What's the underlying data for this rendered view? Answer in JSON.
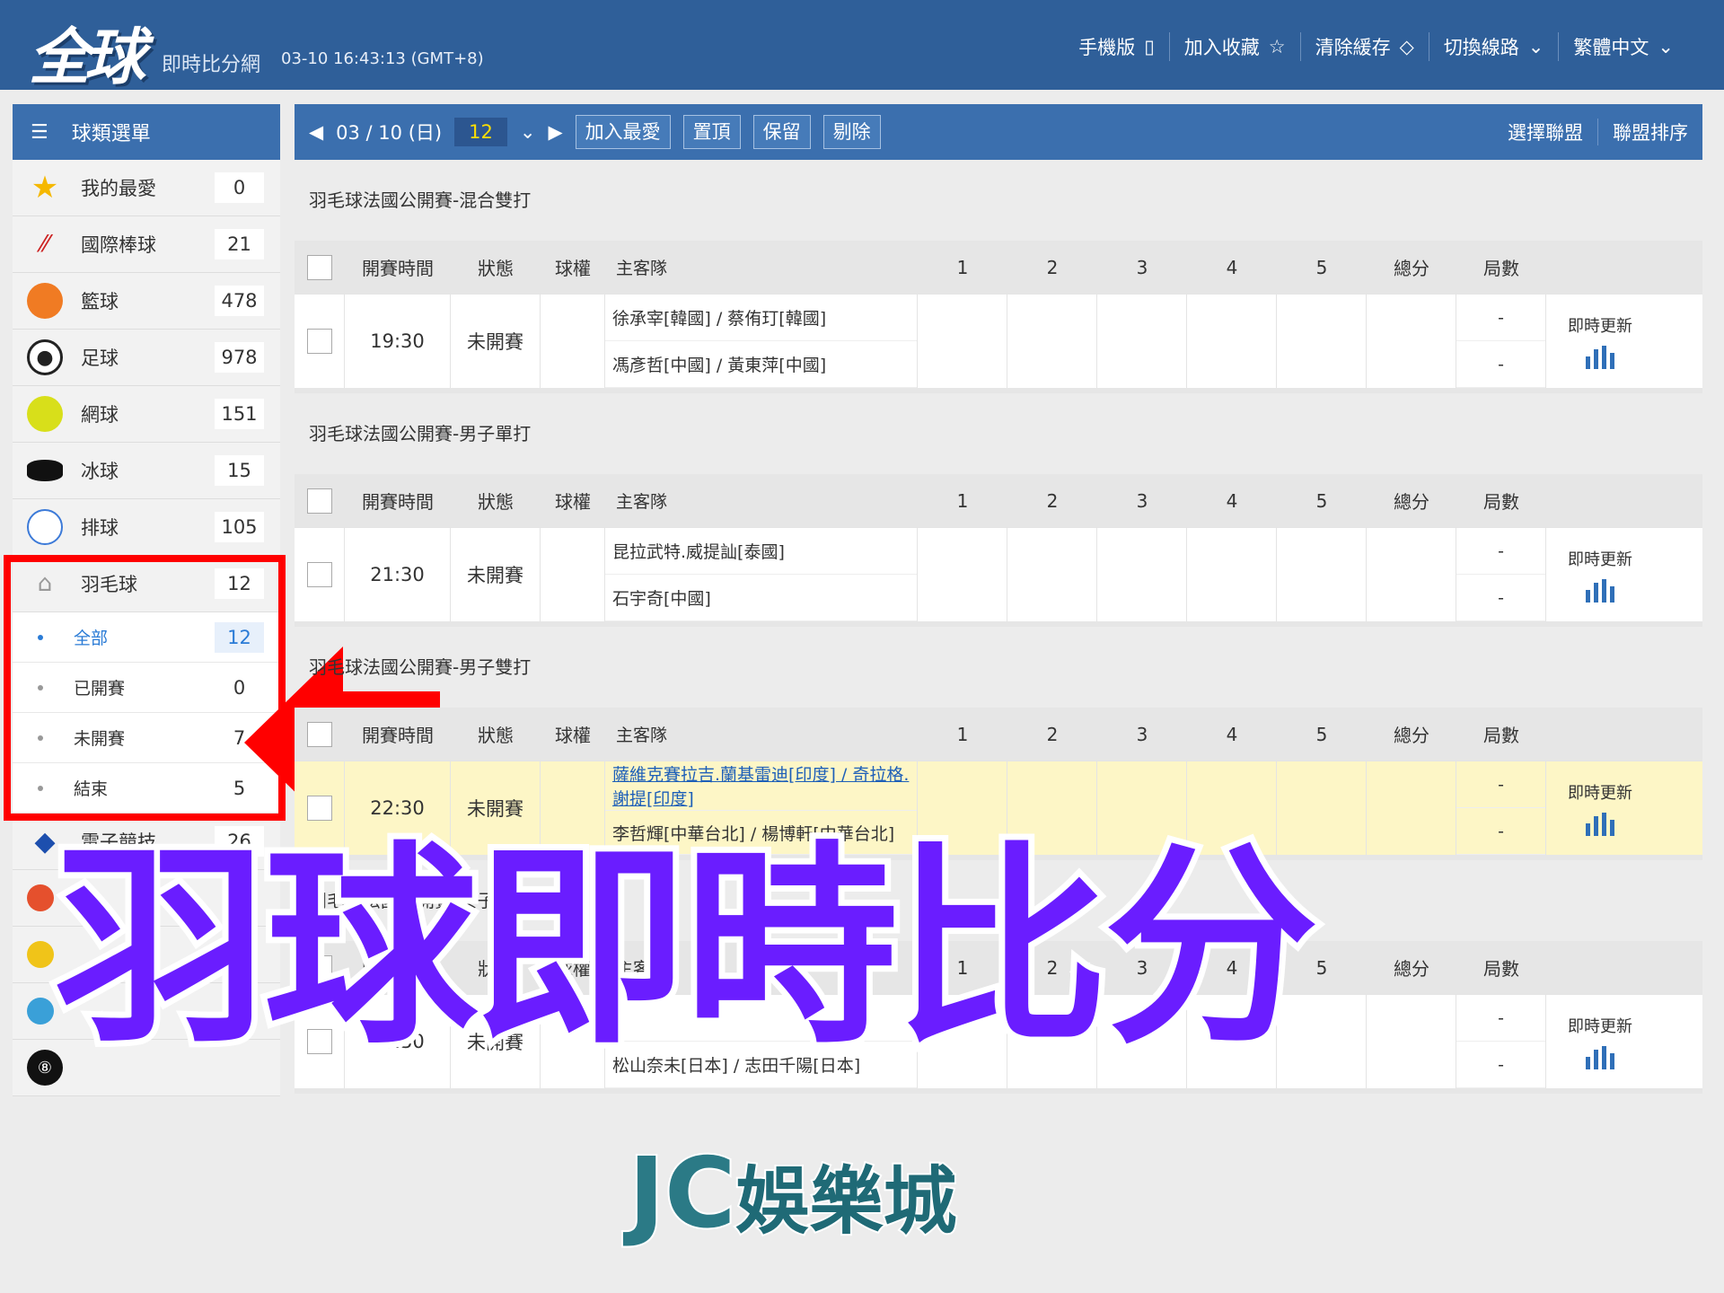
{
  "header": {
    "logo": "全球",
    "subtitle": "即時比分網",
    "clock": "03-10 16:43:13 (GMT+8)",
    "nav": [
      {
        "label": "手機版",
        "icon": "phone-icon"
      },
      {
        "label": "加入收藏",
        "icon": "star-outline-icon"
      },
      {
        "label": "清除緩存",
        "icon": "eraser-icon"
      },
      {
        "label": "切換線路",
        "icon": "chevron-down-icon"
      },
      {
        "label": "繁體中文",
        "icon": "chevron-down-icon"
      }
    ]
  },
  "sidebar": {
    "title": "球類選單",
    "items": [
      {
        "label": "我的最愛",
        "count": "0"
      },
      {
        "label": "國際棒球",
        "count": "21"
      },
      {
        "label": "籃球",
        "count": "478"
      },
      {
        "label": "足球",
        "count": "978"
      },
      {
        "label": "網球",
        "count": "151"
      },
      {
        "label": "冰球",
        "count": "15"
      },
      {
        "label": "排球",
        "count": "105"
      },
      {
        "label": "羽毛球",
        "count": "12"
      }
    ],
    "subitems": [
      {
        "label": "全部",
        "count": "12"
      },
      {
        "label": "已開賽",
        "count": "0"
      },
      {
        "label": "未開賽",
        "count": "7"
      },
      {
        "label": "結束",
        "count": "5"
      }
    ],
    "after": [
      {
        "label": "電子競技",
        "count": "26"
      }
    ]
  },
  "toolbar": {
    "date": "03 / 10 (日)",
    "count": "12",
    "buttons": [
      "加入最愛",
      "置頂",
      "保留",
      "剔除"
    ],
    "right": [
      "選擇聯盟",
      "聯盟排序"
    ]
  },
  "columns": [
    "開賽時間",
    "狀態",
    "球權",
    "主客隊",
    "1",
    "2",
    "3",
    "4",
    "5",
    "總分",
    "局數"
  ],
  "leagues": [
    {
      "name": "羽毛球法國公開賽-混合雙打",
      "time": "19:30",
      "status": "未開賽",
      "home": "徐承宰[韓國] / 蔡侑玎[韓國]",
      "away": "馮彥哲[中國] / 黃東萍[中國]",
      "s1": "-",
      "s2": "-",
      "update": "即時更新"
    },
    {
      "name": "羽毛球法國公開賽-男子單打",
      "time": "21:30",
      "status": "未開賽",
      "home": "昆拉武特.威提訕[泰國]",
      "away": "石宇奇[中國]",
      "s1": "-",
      "s2": "-",
      "update": "即時更新"
    },
    {
      "name": "羽毛球法國公開賽-男子雙打",
      "time": "22:30",
      "status": "未開賽",
      "home": "薩維克賽拉吉.蘭基雷迪[印度] / 奇拉格.謝提[印度]",
      "away": "李哲輝[中華台北] / 楊博軒[中華台北]",
      "s1": "-",
      "s2": "-",
      "update": "即時更新"
    },
    {
      "name": "羽毛球法國公開賽-女子雙打",
      "time": "20:30",
      "status": "未開賽",
      "home": "",
      "away": "松山奈未[日本] / 志田千陽[日本]",
      "s1": "-",
      "s2": "-",
      "update": "即時更新"
    }
  ],
  "overlay": {
    "title": "羽球即時比分",
    "brand": "JC",
    "brand2": "娛樂城"
  }
}
